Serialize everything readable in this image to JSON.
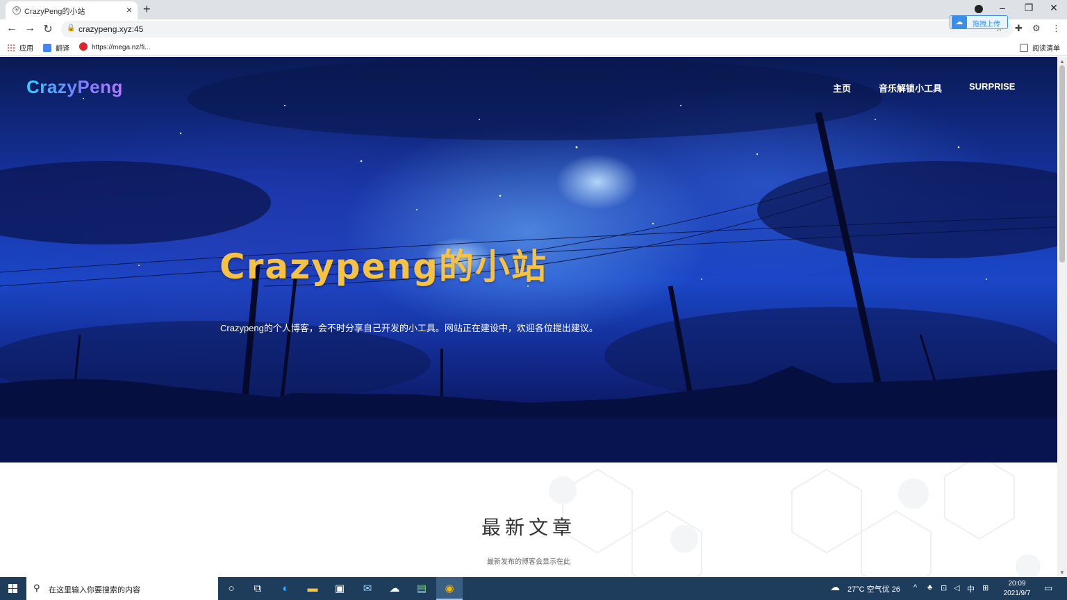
{
  "browser": {
    "tab_title": "CrazyPeng的小站",
    "tab_favicon": "shield-icon",
    "url": "crazypeng.xyz:45",
    "baidu_upload_label": "拖拽上传",
    "bookmarks": [
      {
        "label": "应用",
        "icon": "apps-grid-icon",
        "color": "#e94235"
      },
      {
        "label": "翻译",
        "icon": "translate-icon",
        "color": "#4285f4"
      },
      {
        "label": "https://mega.nz/fi...",
        "icon": "mega-icon",
        "color": "#d9272e"
      }
    ],
    "reading_list": "阅读清单"
  },
  "site": {
    "logo": "CrazyPeng",
    "nav": [
      "主页",
      "音乐解锁小工具",
      "SURPRISE"
    ],
    "hero_title": "Crazypeng的小站",
    "hero_subtitle": "Crazypeng的个人博客，会不时分享自己开发的小工具。网站正在建设中，欢迎各位提出建议。",
    "section_title": "最新文章",
    "section_subtitle": "最新发布的博客会显示在此"
  },
  "taskbar": {
    "search_placeholder": "在这里输入你要搜索的内容",
    "weather": "27°C 空气优 26",
    "ime": "中",
    "time": "20:09",
    "date": "2021/9/7"
  },
  "colors": {
    "hero_title": "#f6c244",
    "taskbar": "#1e3d5c",
    "logo_gradient": [
      "#2fd3ff",
      "#b77bff"
    ]
  }
}
